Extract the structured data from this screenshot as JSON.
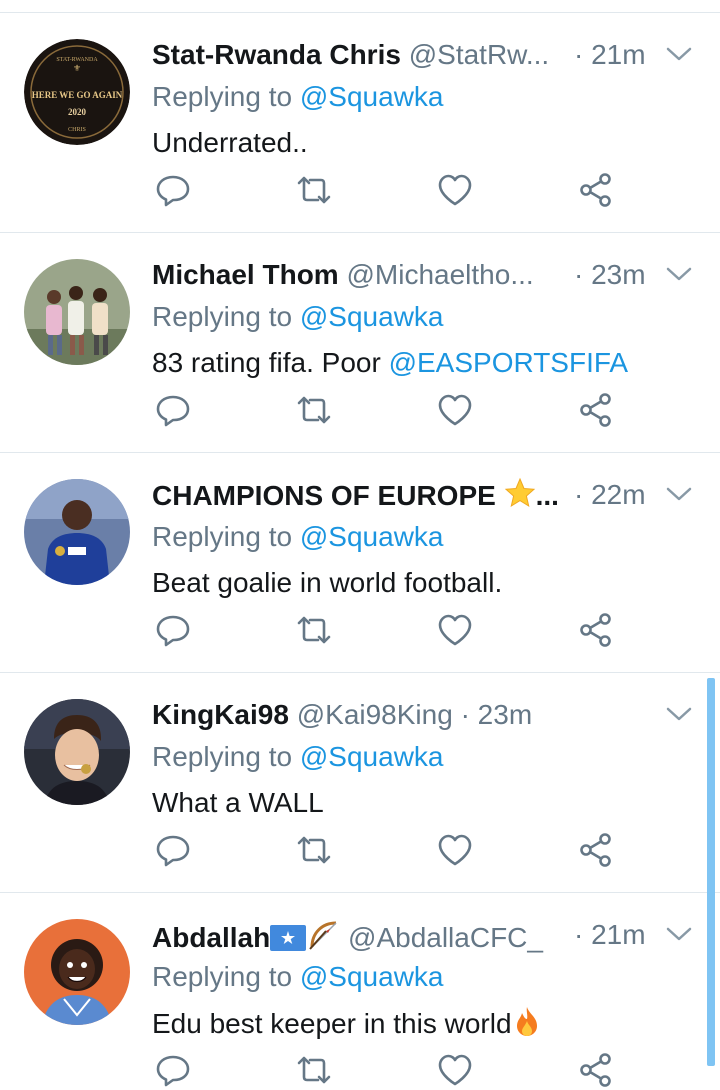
{
  "tweets": [
    {
      "name": "Stat-Rwanda Chris",
      "handle": "@StatRw...",
      "time": "· 21m",
      "replying_label": "Replying to",
      "replying_to": "@Squawka",
      "text": "Underrated..",
      "avatar_text": {
        "top": "STAT-RWANDA",
        "middle": "HERE WE GO AGAIN",
        "year": "2020",
        "bottom": "CHRIS"
      }
    },
    {
      "name": "Michael Thom",
      "handle": "@Michaeltho...",
      "time": "· 23m",
      "replying_label": "Replying to",
      "replying_to": "@Squawka",
      "text": "83 rating fifa. Poor ",
      "mention": "@EASPORTSFIFA"
    },
    {
      "name": "CHAMPIONS OF EUROPE",
      "name_suffix": "...",
      "handle": "",
      "time": "· 22m",
      "replying_label": "Replying to",
      "replying_to": "@Squawka",
      "text": "Beat goalie in world football."
    },
    {
      "name": "KingKai98",
      "handle": "@Kai98King · 23m",
      "time": "",
      "replying_label": "Replying to",
      "replying_to": "@Squawka",
      "text": "What a WALL"
    },
    {
      "name": "Abdallah",
      "handle": "@AbdallaCFC_",
      "time": "· 21m",
      "replying_label": "Replying to",
      "replying_to": "@Squawka",
      "text": "Edu best keeper in this world"
    }
  ],
  "icons": {
    "reply": "reply-icon",
    "retweet": "retweet-icon",
    "like": "heart-icon",
    "share": "share-icon",
    "caret": "chevron-down-icon"
  },
  "colors": {
    "link": "#1b95e0",
    "secondary": "#657786",
    "primary_text": "#14171a",
    "divider": "#e1e8ed",
    "thread_bar": "#7fc4f3"
  }
}
